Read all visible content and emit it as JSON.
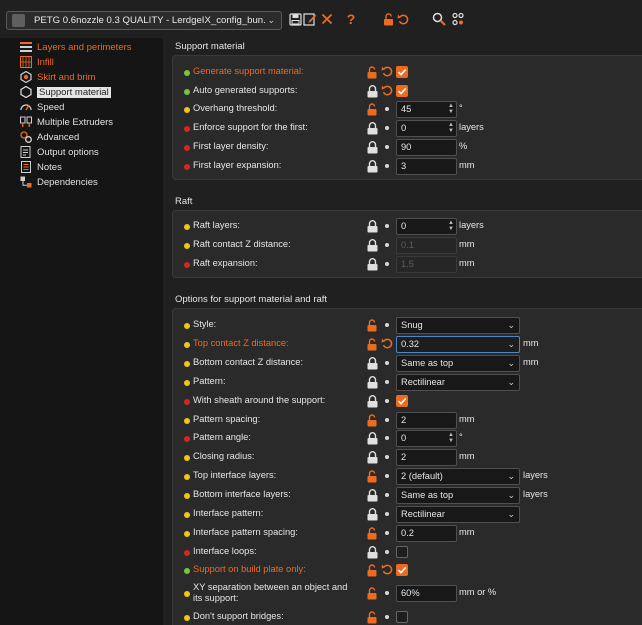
{
  "toolbar": {
    "preset_name": "PETG 0.6nozzle 0.3 QUALITY - LerdgeIX_config_bun..."
  },
  "colors": {
    "accent_orange": "#ED6B21",
    "dot_green": "#78C53F",
    "dot_yellow": "#F0C419",
    "dot_red": "#D8261F"
  },
  "sidebar": {
    "items": [
      {
        "label": "Layers and perimeters",
        "icon": "layers-icon"
      },
      {
        "label": "Infill",
        "icon": "infill-icon"
      },
      {
        "label": "Skirt and brim",
        "icon": "skirt-brim-icon"
      },
      {
        "label": "Support material",
        "icon": "support-icon"
      },
      {
        "label": "Speed",
        "icon": "speed-icon"
      },
      {
        "label": "Multiple Extruders",
        "icon": "extruders-icon"
      },
      {
        "label": "Advanced",
        "icon": "advanced-icon"
      },
      {
        "label": "Output options",
        "icon": "output-icon"
      },
      {
        "label": "Notes",
        "icon": "notes-icon"
      },
      {
        "label": "Dependencies",
        "icon": "dependencies-icon"
      }
    ]
  },
  "groups": {
    "support": {
      "title": "Support material",
      "rows": [
        {
          "label": "Generate support material:",
          "value": "",
          "unit": ""
        },
        {
          "label": "Auto generated supports:",
          "value": "",
          "unit": ""
        },
        {
          "label": "Overhang threshold:",
          "value": "45",
          "unit": "°"
        },
        {
          "label": "Enforce support for the first:",
          "value": "0",
          "unit": "layers"
        },
        {
          "label": "First layer density:",
          "value": "90",
          "unit": "%"
        },
        {
          "label": "First layer expansion:",
          "value": "3",
          "unit": "mm"
        }
      ]
    },
    "raft": {
      "title": "Raft",
      "rows": [
        {
          "label": "Raft layers:",
          "value": "0",
          "unit": "layers"
        },
        {
          "label": "Raft contact Z distance:",
          "value": "0.1",
          "unit": "mm"
        },
        {
          "label": "Raft expansion:",
          "value": "1.5",
          "unit": "mm"
        }
      ]
    },
    "options": {
      "title": "Options for support material and raft",
      "rows": [
        {
          "label": "Style:",
          "value": "Snug",
          "unit": ""
        },
        {
          "label": "Top contact Z distance:",
          "value": "0.32",
          "unit": "mm"
        },
        {
          "label": "Bottom contact Z distance:",
          "value": "Same as top",
          "unit": "mm"
        },
        {
          "label": "Pattern:",
          "value": "Rectilinear",
          "unit": ""
        },
        {
          "label": "With sheath around the support:",
          "value": "",
          "unit": ""
        },
        {
          "label": "Pattern spacing:",
          "value": "2",
          "unit": "mm"
        },
        {
          "label": "Pattern angle:",
          "value": "0",
          "unit": "°"
        },
        {
          "label": "Closing radius:",
          "value": "2",
          "unit": "mm"
        },
        {
          "label": "Top interface layers:",
          "value": "2 (default)",
          "unit": "layers"
        },
        {
          "label": "Bottom interface layers:",
          "value": "Same as top",
          "unit": "layers"
        },
        {
          "label": "Interface pattern:",
          "value": "Rectilinear",
          "unit": ""
        },
        {
          "label": "Interface pattern spacing:",
          "value": "0.2",
          "unit": "mm"
        },
        {
          "label": "Interface loops:",
          "value": "",
          "unit": ""
        },
        {
          "label": "Support on build plate only:",
          "value": "",
          "unit": ""
        },
        {
          "label_line1": "XY separation between an object and",
          "label_line2": "its support:",
          "value": "60%",
          "unit": "mm or %"
        },
        {
          "label": "Don't support bridges:",
          "value": "",
          "unit": ""
        }
      ]
    }
  }
}
